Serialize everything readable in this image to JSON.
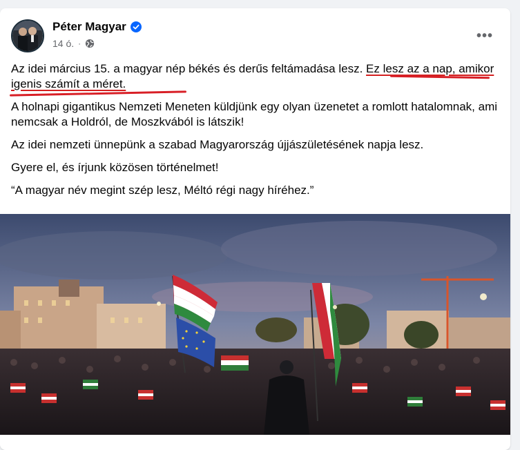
{
  "post": {
    "author": "Péter Magyar",
    "timestamp": "14 ó.",
    "separator": "·",
    "more_label": "•••",
    "paragraph1_plain": "Az idei március 15. a magyar nép békés és derűs feltámadása lesz. ",
    "paragraph1_highlight": "Ez lesz az a nap, amikor igenis számít a méret.",
    "paragraph2": "A holnapi gigantikus Nemzeti Meneten küldjünk egy olyan üzenetet a romlott hatalomnak, ami nemcsak a Holdról, de Moszkvából is látszik!",
    "paragraph3": "Az idei nemzeti ünnepünk a szabad Magyarország újjászületésének napja lesz.",
    "paragraph4": "Gyere el, és írjunk közösen történelmet!",
    "paragraph5": "“A magyar név megint szép lesz, Méltó régi nagy híréhez.”"
  },
  "icons": {
    "verified": "verified-badge-icon",
    "audience": "globe-icon",
    "more": "more-horizontal-icon"
  },
  "colors": {
    "verified_blue": "#0866ff",
    "annotation_red": "#d81f26",
    "meta_gray": "#65676b"
  }
}
